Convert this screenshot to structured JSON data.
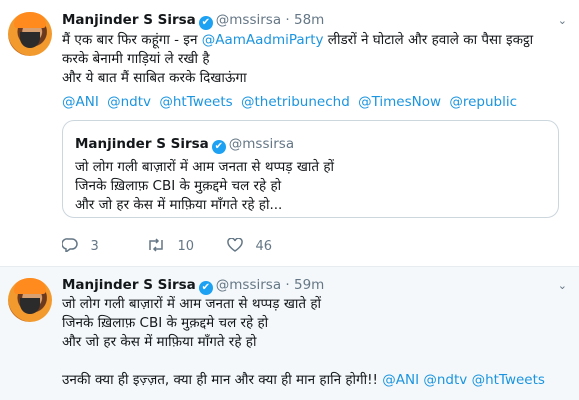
{
  "tweet1": {
    "name": "Manjinder S Sirsa",
    "handle": "@mssirsa",
    "dot": "·",
    "time": "58m",
    "line1_pre": "मैं एक बार फिर कहूंगा - इन ",
    "line1_link": "@AamAadmiParty",
    "line1_post": " लीडरों ने घोटाले और हवाले का पैसा इकट्ठा",
    "line2": "करके बेनामी गाड़ियां ले रखी है",
    "line3": "और ये बात मैं साबित करके दिखाऊंगा",
    "mentions": [
      "@ANI",
      "@ndtv",
      "@htTweets",
      "@thetribunechd",
      "@TimesNow",
      "@republic"
    ],
    "quote": {
      "name": "Manjinder S Sirsa",
      "handle": "@mssirsa",
      "line1": "जो लोग गली बाज़ारों में आम जनता से थप्पड़ खाते हों",
      "line2": "जिनके ख़िलाफ़ CBI के मुक़द्दमे चल रहे हो",
      "line3": "और जो हर केस में माफ़िया माँगते रहे हो..."
    },
    "actions": {
      "reply_count": "3",
      "retweet_count": "10",
      "like_count": "46",
      "reply_icon": "reply-icon",
      "retweet_icon": "retweet-icon",
      "like_icon": "heart-icon"
    }
  },
  "tweet2": {
    "name": "Manjinder S Sirsa",
    "handle": "@mssirsa",
    "dot": "·",
    "time": "59m",
    "line1": "जो लोग गली बाज़ारों में आम जनता से थप्पड़ खाते हों",
    "line2": "जिनके ख़िलाफ़ CBI के मुक़द्दमे चल रहे हो",
    "line3": "और जो हर केस में माफ़िया माँगते रहे हो",
    "line4_pre": "उनकी क्या ही इज़्ज़त, क्या ही मान और क्या ही मान हानि होगी!! ",
    "mentions": [
      "@ANI",
      "@ndtv",
      "@htTweets"
    ]
  },
  "colors": {
    "link": "#1b95e0",
    "verified": "#1da1f2",
    "muted": "#657786",
    "highlight_bg": "#f5f8fa"
  }
}
